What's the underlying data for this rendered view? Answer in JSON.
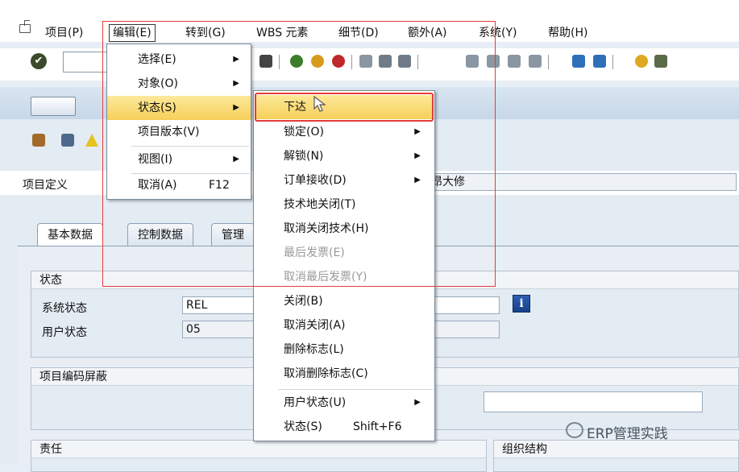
{
  "menubar": {
    "items": [
      "项目(P)",
      "编辑(E)",
      "转到(G)",
      "WBS 元素",
      "细节(D)",
      "额外(A)",
      "系统(Y)",
      "帮助(H)"
    ]
  },
  "toolbar": {
    "check": "✔"
  },
  "edit_menu": {
    "items": [
      "选择(E)",
      "对象(O)",
      "状态(S)",
      "项目版本(V)",
      "视图(I)",
      "取消(A)"
    ],
    "cancel_shortcut": "F12"
  },
  "status_menu": {
    "items": [
      "下达",
      "锁定(O)",
      "解锁(N)",
      "订单接收(D)",
      "技术地关闭(T)",
      "取消关闭技术(H)",
      "最后发票(E)",
      "取消最后发票(Y)",
      "关闭(B)",
      "取消关闭(A)",
      "删除标志(L)",
      "取消删除标志(C)",
      "用户状态(U)",
      "状态(S)"
    ],
    "status_shortcut": "Shift+F6"
  },
  "form": {
    "project_def_label": "项目定义",
    "project_def_text": "昂大修",
    "tabs": [
      "基本数据",
      "控制数据",
      "管理"
    ],
    "status_group": "状态",
    "system_status_label": "系统状态",
    "system_status_value": "REL",
    "user_status_label": "用户状态",
    "user_status_value": "05",
    "info_btn": "i",
    "mask_group": "项目编码屏蔽",
    "resp_group": "责任",
    "org_group": "组织结构"
  },
  "watermark": "ERP管理实践"
}
